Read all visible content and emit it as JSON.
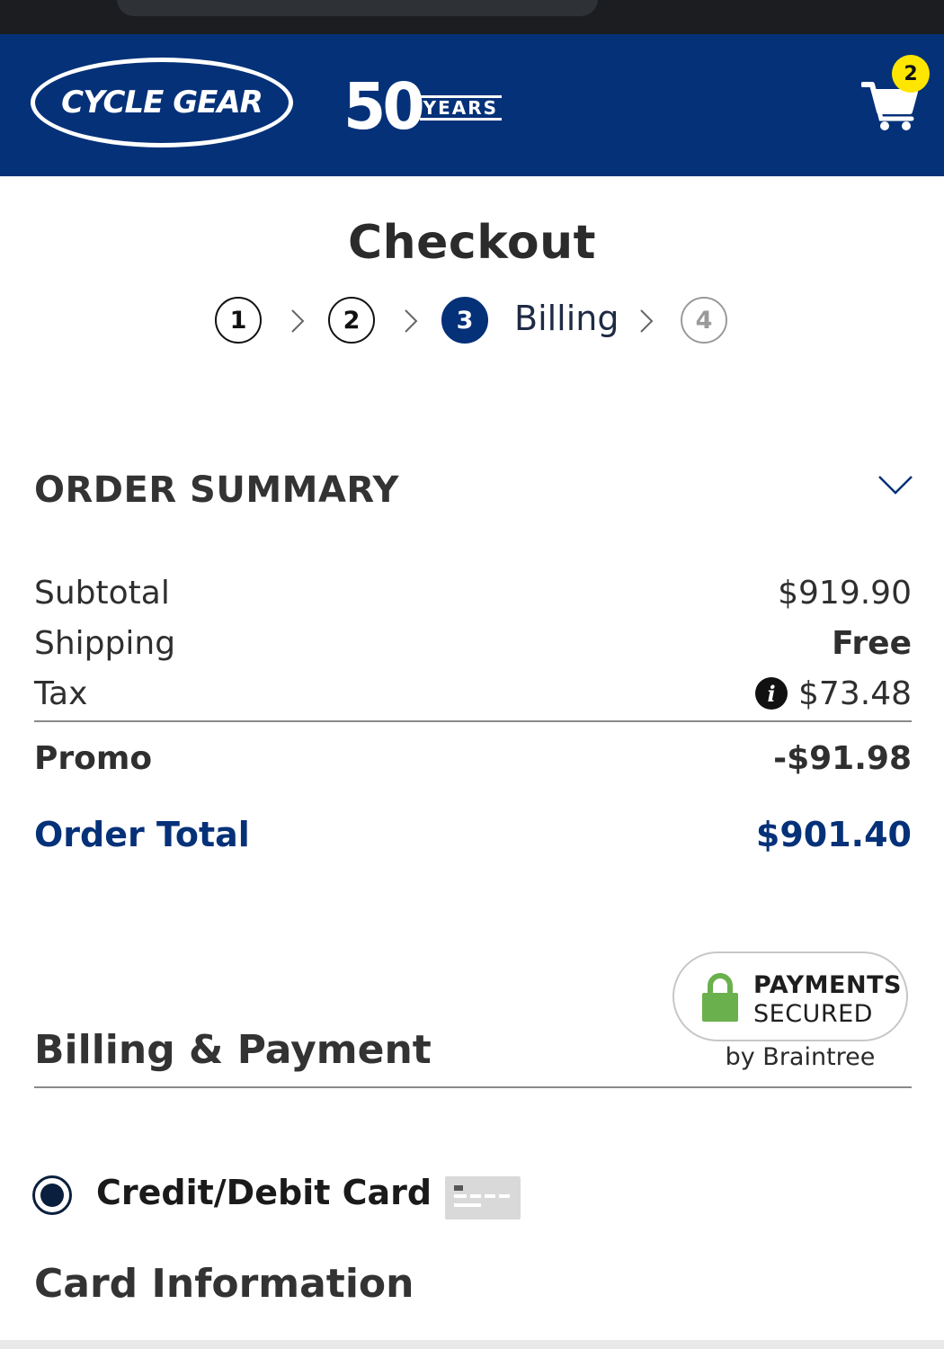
{
  "header": {
    "brand": "CYCLE GEAR",
    "anniversary_number": "50",
    "anniversary_word": "YEARS",
    "cart_count": "2",
    "colors": {
      "header_bg": "#053179",
      "badge": "#ffe600"
    }
  },
  "checkout": {
    "title": "Checkout",
    "steps": [
      {
        "number": "1",
        "state": "completed"
      },
      {
        "number": "2",
        "state": "completed"
      },
      {
        "number": "3",
        "state": "active",
        "label": "Billing"
      },
      {
        "number": "4",
        "state": "upcoming"
      }
    ]
  },
  "order_summary": {
    "title": "ORDER SUMMARY",
    "toggle_icon": "chevron-down-icon",
    "subtotal": {
      "label": "Subtotal",
      "value": "$919.90"
    },
    "shipping": {
      "label": "Shipping",
      "value": "Free"
    },
    "tax": {
      "label": "Tax",
      "value": "$73.48",
      "icon": "info-icon",
      "icon_glyph": "i"
    },
    "promo": {
      "label": "Promo",
      "value": "-$91.98"
    },
    "total": {
      "label": "Order Total",
      "value": "$901.40"
    }
  },
  "billing": {
    "title": "Billing & Payment",
    "secure_badge": {
      "line1": "PAYMENTS",
      "line2": "SECURED",
      "provider": "by Braintree",
      "icon": "lock-icon",
      "lock_color": "#6ab04c"
    },
    "payment_method": {
      "label": "Credit/Debit Card",
      "selected": true,
      "icon": "credit-card-icon"
    },
    "card_info_title": "Card Information"
  }
}
